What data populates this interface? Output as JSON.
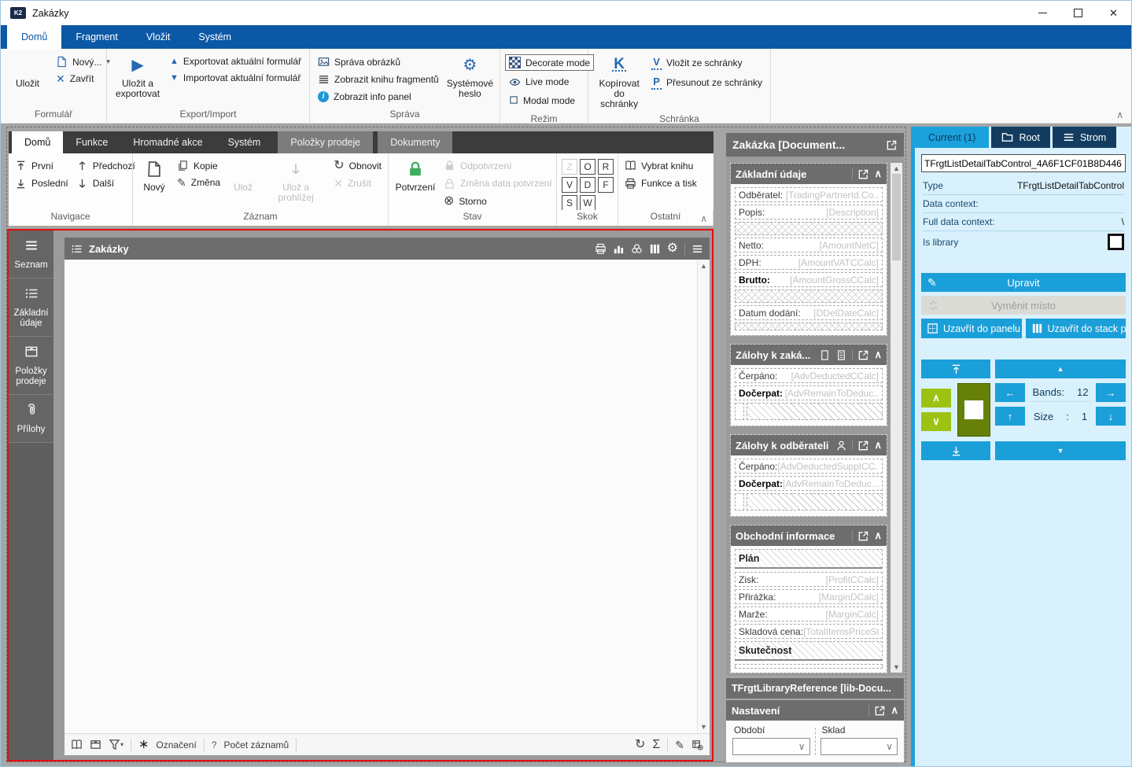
{
  "window": {
    "title": "Zakázky",
    "app_icon_label": "K2"
  },
  "icons": {
    "check": "✓",
    "close": "✕",
    "chevron_up": "∧",
    "chevron_down": "∨",
    "dropdown": "▾",
    "tri_up": "▲",
    "tri_down": "▼",
    "tri_right": "▶",
    "arrow_up": "↑",
    "arrow_down": "↓",
    "arrow_left": "←",
    "arrow_right": "→",
    "refresh": "↻",
    "sigma": "Σ",
    "gear": "⚙",
    "pencil": "✎",
    "asterisk": "∗",
    "storno": "⊗",
    "menu": "≡",
    "maximize": "□",
    "minimize": "–",
    "info": "i"
  },
  "ribbon": {
    "tabs": [
      "Domů",
      "Fragment",
      "Vložit",
      "Systém"
    ],
    "formular": {
      "label": "Formulář",
      "save": "Uložit",
      "new": "Nový...",
      "close": "Zavřít"
    },
    "export_import": {
      "label": "Export/Import",
      "save_export": "Uložit a exportovat",
      "export_form": "Exportovat aktuální formulář",
      "import_form": "Importovat aktuální formulář"
    },
    "sprava": {
      "label": "Správa",
      "images": "Správa obrázků",
      "fragments": "Zobrazit knihu fragmentů",
      "info_panel": "Zobrazit info panel",
      "system_password": "Systémové heslo"
    },
    "rezim": {
      "label": "Režim",
      "decorate": "Decorate mode",
      "live": "Live mode",
      "modal": "Modal mode"
    },
    "schranka": {
      "label": "Schránka",
      "copy": "Kopírovat do schránky",
      "paste": "Vložit ze schránky",
      "move": "Přesunout ze schránky",
      "copy_key": "K",
      "paste_key": "V",
      "move_key": "P"
    }
  },
  "form_ribbon": {
    "tabs": [
      "Domů",
      "Funkce",
      "Hromadné akce",
      "Systém",
      "Položky prodeje",
      "Dokumenty"
    ],
    "navigace": {
      "label": "Navigace",
      "first": "První",
      "prev": "Předchozí",
      "last": "Poslední",
      "next": "Další"
    },
    "zaznam": {
      "label": "Záznam",
      "new": "Nový",
      "copy": "Kopie",
      "change": "Změna",
      "save": "Ulož",
      "save_view": "Ulož a prohlížej",
      "refresh": "Obnovit",
      "cancel": "Zrušit"
    },
    "stav": {
      "label": "Stav",
      "confirm": "Potvrzení",
      "unconfirm": "Odpotvrzení",
      "change_date": "Změna data potvrzení",
      "storno": "Storno"
    },
    "skok": {
      "label": "Skok",
      "keys": [
        "Z",
        "O",
        "R",
        "V",
        "D",
        "F",
        "S",
        "W"
      ]
    },
    "ostatni": {
      "label": "Ostatní",
      "select_book": "Vybrat knihu",
      "print": "Funkce a tisk"
    }
  },
  "sidebar": {
    "items": [
      "Seznam",
      "Základní údaje",
      "Položky prodeje",
      "Přílohy"
    ]
  },
  "list_panel": {
    "title": "Zakázky",
    "mark_label": "Označení",
    "count_prefix": "?",
    "count_label": "Počet záznamů"
  },
  "detail": {
    "title": "Zakázka [Document...",
    "zakladni": {
      "title": "Základní údaje",
      "f0l": "Odběratel:",
      "f0v": "[TradingPartnerId.Co..",
      "f1l": "Popis:",
      "f1v": "[Description]",
      "f2l": "Netto:",
      "f2v": "[AmountNetC]",
      "f3l": "DPH:",
      "f3v": "[AmountVATCCalc]",
      "f4l": "Brutto:",
      "f4v": "[AmountGrossCCalc]",
      "f5l": "Datum dodání:",
      "f5v": "[DDelDateCalc]"
    },
    "zalohy_zakazka": {
      "title": "Zálohy k zaká...",
      "f0l": "Čerpáno:",
      "f0v": "[AdvDeductedCCalc]",
      "f1l": "Dočerpat:",
      "f1v": "[AdvRemainToDeduc.."
    },
    "zalohy_odberatel": {
      "title": "Zálohy k odběrateli",
      "f0l": "Čerpáno:",
      "f0v": "[AdvDeductedSuppICC..",
      "f1l": "Dočerpat:",
      "f1v": "[AdvRemainToDeduc..."
    },
    "obchodni": {
      "title": "Obchodní informace",
      "plan": "Plán",
      "f0l": "Zisk:",
      "f0v": "[ProfitCCalc]",
      "f1l": "Přirážka:",
      "f1v": "[MarginDCalc]",
      "f2l": "Marže:",
      "f2v": "[MarginCalc]",
      "f3l": "Skladová cena:",
      "f3v": "[TotalItemsPriceSt..",
      "skutecnost": "Skutečnost"
    },
    "library_title": "TFrgtLibraryReference [lib-Docu...",
    "nastaveni": {
      "title": "Nastavení",
      "combo1_label": "Období",
      "combo2_label": "Sklad"
    }
  },
  "inspector": {
    "tab_current": "Current (1)",
    "tab_root": "Root",
    "tab_strom": "Strom",
    "control_id": "TFrgtListDetailTabControl_4A6F1CF01B8D446",
    "type_label": "Type",
    "type_value": "TFrgtListDetailTabControl",
    "data_context_label": "Data context:",
    "data_context_value": "",
    "full_context_label": "Full data context:",
    "full_context_value": "\\",
    "is_library_label": "Is library",
    "btn_edit": "Upravit",
    "btn_swap": "Vyměnit místo",
    "btn_dock_panel": "Uzavřít do panelu",
    "btn_dock_stack": "Uzavřít do stack p...",
    "bands_label": "Bands:",
    "bands_value": "12",
    "size_label": "Size",
    "size_colon": ":",
    "size_value": "1"
  },
  "colors": {
    "ribbon_blue": "#0b59a6",
    "accent_blue": "#1b9fd9",
    "navy": "#123d60",
    "green": "#9dc212",
    "olive": "#66800a",
    "red_border": "#e60c0c",
    "panel_gray": "#6d6d6d",
    "dark_tabbar": "#3c3c3c",
    "confirm_green": "#3fae5e"
  }
}
